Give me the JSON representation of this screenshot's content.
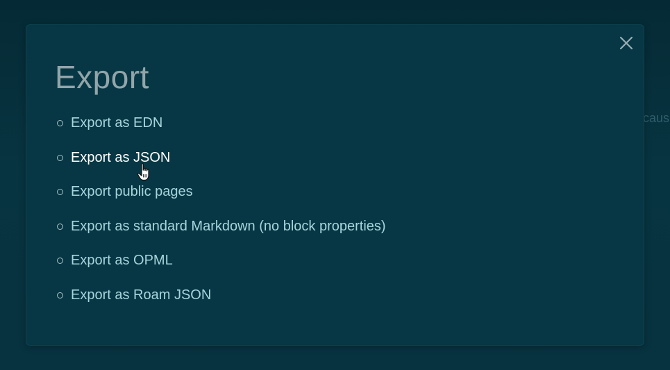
{
  "backdrop": {
    "partial_text": "caus"
  },
  "modal": {
    "title": "Export",
    "close_icon": "close-icon",
    "items": [
      {
        "label": "Export as EDN",
        "hovered": false
      },
      {
        "label": "Export as JSON",
        "hovered": true
      },
      {
        "label": "Export public pages",
        "hovered": false
      },
      {
        "label": "Export as standard Markdown (no block properties)",
        "hovered": false
      },
      {
        "label": "Export as OPML",
        "hovered": false
      },
      {
        "label": "Export as Roam JSON",
        "hovered": false
      }
    ]
  },
  "colors": {
    "background": "#073441",
    "modal_background": "#073744",
    "title": "#93a5aa",
    "link": "#a8d5dc",
    "link_hover": "#ffffff"
  },
  "cursor": {
    "icon": "hand-pointer-icon"
  }
}
